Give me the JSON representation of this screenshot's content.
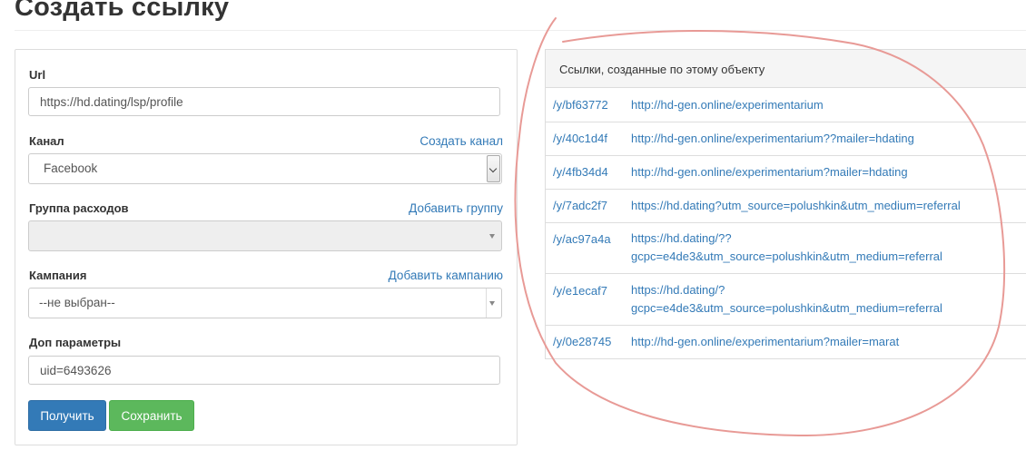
{
  "page": {
    "title": "Создать ссылку"
  },
  "form": {
    "url": {
      "label": "Url",
      "value": "https://hd.dating/lsp/profile"
    },
    "channel": {
      "label": "Канал",
      "link": "Создать канал",
      "value": "Facebook"
    },
    "expense_group": {
      "label": "Группа расходов",
      "link": "Добавить группу",
      "value": ""
    },
    "campaign": {
      "label": "Кампания",
      "link": "Добавить кампанию",
      "value": "--не выбран--"
    },
    "extra_params": {
      "label": "Доп параметры",
      "value": "uid=6493626"
    },
    "buttons": {
      "get": "Получить",
      "save": "Сохранить"
    }
  },
  "links": {
    "header": "Ссылки, созданные по этому объекту",
    "rows": [
      {
        "short": "/y/bf63772",
        "long": "http://hd-gen.online/experimentarium"
      },
      {
        "short": "/y/40c1d4f",
        "long": "http://hd-gen.online/experimentarium??mailer=hdating"
      },
      {
        "short": "/y/4fb34d4",
        "long": "http://hd-gen.online/experimentarium?mailer=hdating"
      },
      {
        "short": "/y/7adc2f7",
        "long": "https://hd.dating?utm_source=polushkin&utm_medium=referral"
      },
      {
        "short": "/y/ac97a4a",
        "long": "https://hd.dating/??gcpc=e4de3&utm_source=polushkin&utm_medium=referral"
      },
      {
        "short": "/y/e1ecaf7",
        "long": "https://hd.dating/?gcpc=e4de3&utm_source=polushkin&utm_medium=referral"
      },
      {
        "short": "/y/0e28745",
        "long": "http://hd-gen.online/experimentarium?mailer=marat"
      }
    ]
  },
  "colors": {
    "link": "#337ab7",
    "primary": "#337ab7",
    "success": "#5cb85c",
    "annotation": "#e89a96"
  }
}
